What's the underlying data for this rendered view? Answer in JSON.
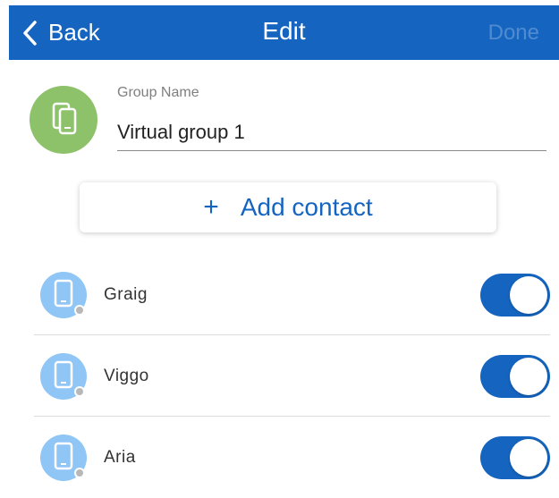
{
  "nav": {
    "back_label": "Back",
    "title": "Edit",
    "done_label": "Done"
  },
  "group": {
    "name_label": "Group Name",
    "name_value": "Virtual group 1",
    "icon": "devices-icon"
  },
  "add_contact": {
    "icon": "plus",
    "label": "Add contact"
  },
  "contacts": [
    {
      "name": "Graig",
      "icon": "phone-icon",
      "enabled": true
    },
    {
      "name": "Viggo",
      "icon": "phone-icon",
      "enabled": true
    },
    {
      "name": "Aria",
      "icon": "phone-icon",
      "enabled": true
    }
  ],
  "colors": {
    "primary": "#1565c0",
    "group_avatar": "#8dc26b",
    "contact_avatar": "#90c6f5"
  }
}
